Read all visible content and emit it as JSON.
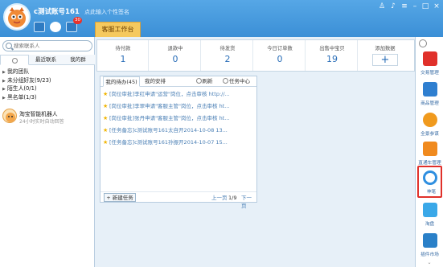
{
  "header": {
    "username": "c测试账号161",
    "signature": "点此输入个性签名",
    "message_badge": "30",
    "workbench_tab": "客服工作台",
    "window_controls": [
      "shirt-icon",
      "bell-icon",
      "menu-icon",
      "minimize-icon",
      "maximize-icon",
      "close-icon"
    ]
  },
  "left": {
    "search_placeholder": "搜索联系人",
    "tabs": [
      "",
      "最近联系",
      "我的群"
    ],
    "groups": [
      {
        "label": "我的团队"
      },
      {
        "label": "未分组好友(9/23)"
      },
      {
        "label": "陌生人(0/1)"
      },
      {
        "label": "黑名单(1/3)"
      }
    ],
    "robot": {
      "name": "淘宝智能机器人",
      "subtitle": "24小时实时自动回答"
    }
  },
  "stats": [
    {
      "label": "待付款",
      "value": "1"
    },
    {
      "label": "退款中",
      "value": "0"
    },
    {
      "label": "待发货",
      "value": "2"
    },
    {
      "label": "今日订单数",
      "value": "0"
    },
    {
      "label": "出售中宝贝",
      "value": "19"
    },
    {
      "label": "添加数据",
      "value": "+"
    }
  ],
  "tasks": {
    "tabs": [
      "我的待办(45)",
      "我的安排",
      "刷新",
      "任务中心"
    ],
    "items": [
      "[岗位审批]李红申请\"运营\"岗位，点击审核 http://...",
      "[岗位审批]李翠申请\"客服主管\"岗位，点击审核 ht...",
      "[岗位审批]张丹申请\"客服主管\"岗位，点击审核 ht...",
      "[任务备忘]c测试账号161太自开2014-10-08 13...",
      "[任务备忘]c测试账号161孙振开2014-10-07 15..."
    ],
    "new_task": "+ 新建任务",
    "prev": "上一页",
    "page": "1/9",
    "next": "下一页"
  },
  "sidebar": {
    "items": [
      {
        "label": "交易管理",
        "color": "#e0302a"
      },
      {
        "label": "商品管理",
        "color": "#2f7fd0"
      },
      {
        "label": "全景参谋",
        "color": "#f09a1e"
      },
      {
        "label": "直通车管理",
        "color": "#f08a1e"
      },
      {
        "label": "神笔",
        "color": "#2f8fe0",
        "selected": true
      },
      {
        "label": "淘盘",
        "color": "#3aa8e8"
      },
      {
        "label": "插件市场",
        "color": "#2a80c8"
      }
    ]
  },
  "colors": {
    "header_blue": "#3b8fd6",
    "stat_value": "#2a6eb8",
    "link_blue": "#4a7fb5",
    "tab_orange": "#f5c95e",
    "selected_border": "#e0302a"
  }
}
